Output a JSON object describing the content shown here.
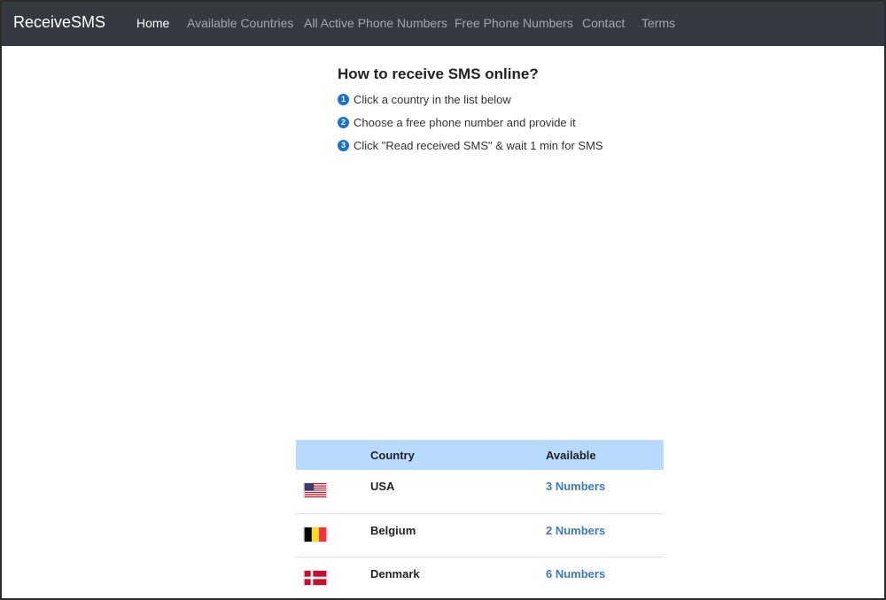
{
  "header": {
    "brand": "ReceiveSMS",
    "nav": [
      "Home",
      "Available Countries",
      "All Active Phone Numbers",
      "Free Phone Numbers",
      "Contact",
      "Terms"
    ],
    "active_index": 0
  },
  "howto": {
    "title": "How to receive SMS online?",
    "steps": [
      {
        "num": "1",
        "text": "Click a country in the list below"
      },
      {
        "num": "2",
        "text": "Choose a free phone number and provide it"
      },
      {
        "num": "3",
        "text": "Click \"Read received SMS\" & wait 1 min for SMS"
      }
    ]
  },
  "table": {
    "headers": [
      "Country",
      "Available"
    ],
    "rows": [
      {
        "country": "USA",
        "available": "3 Numbers",
        "flag_icon": "usa-flag-icon"
      },
      {
        "country": "Belgium",
        "available": "2 Numbers",
        "flag_icon": "belgium-flag-icon"
      },
      {
        "country": "Denmark",
        "available": "6 Numbers",
        "flag_icon": "denmark-flag-icon"
      }
    ]
  },
  "colors": {
    "navbar": "#343a40",
    "table_header": "#b8daff",
    "link": "#3a7abf",
    "step_badge": "#1a73c8"
  }
}
